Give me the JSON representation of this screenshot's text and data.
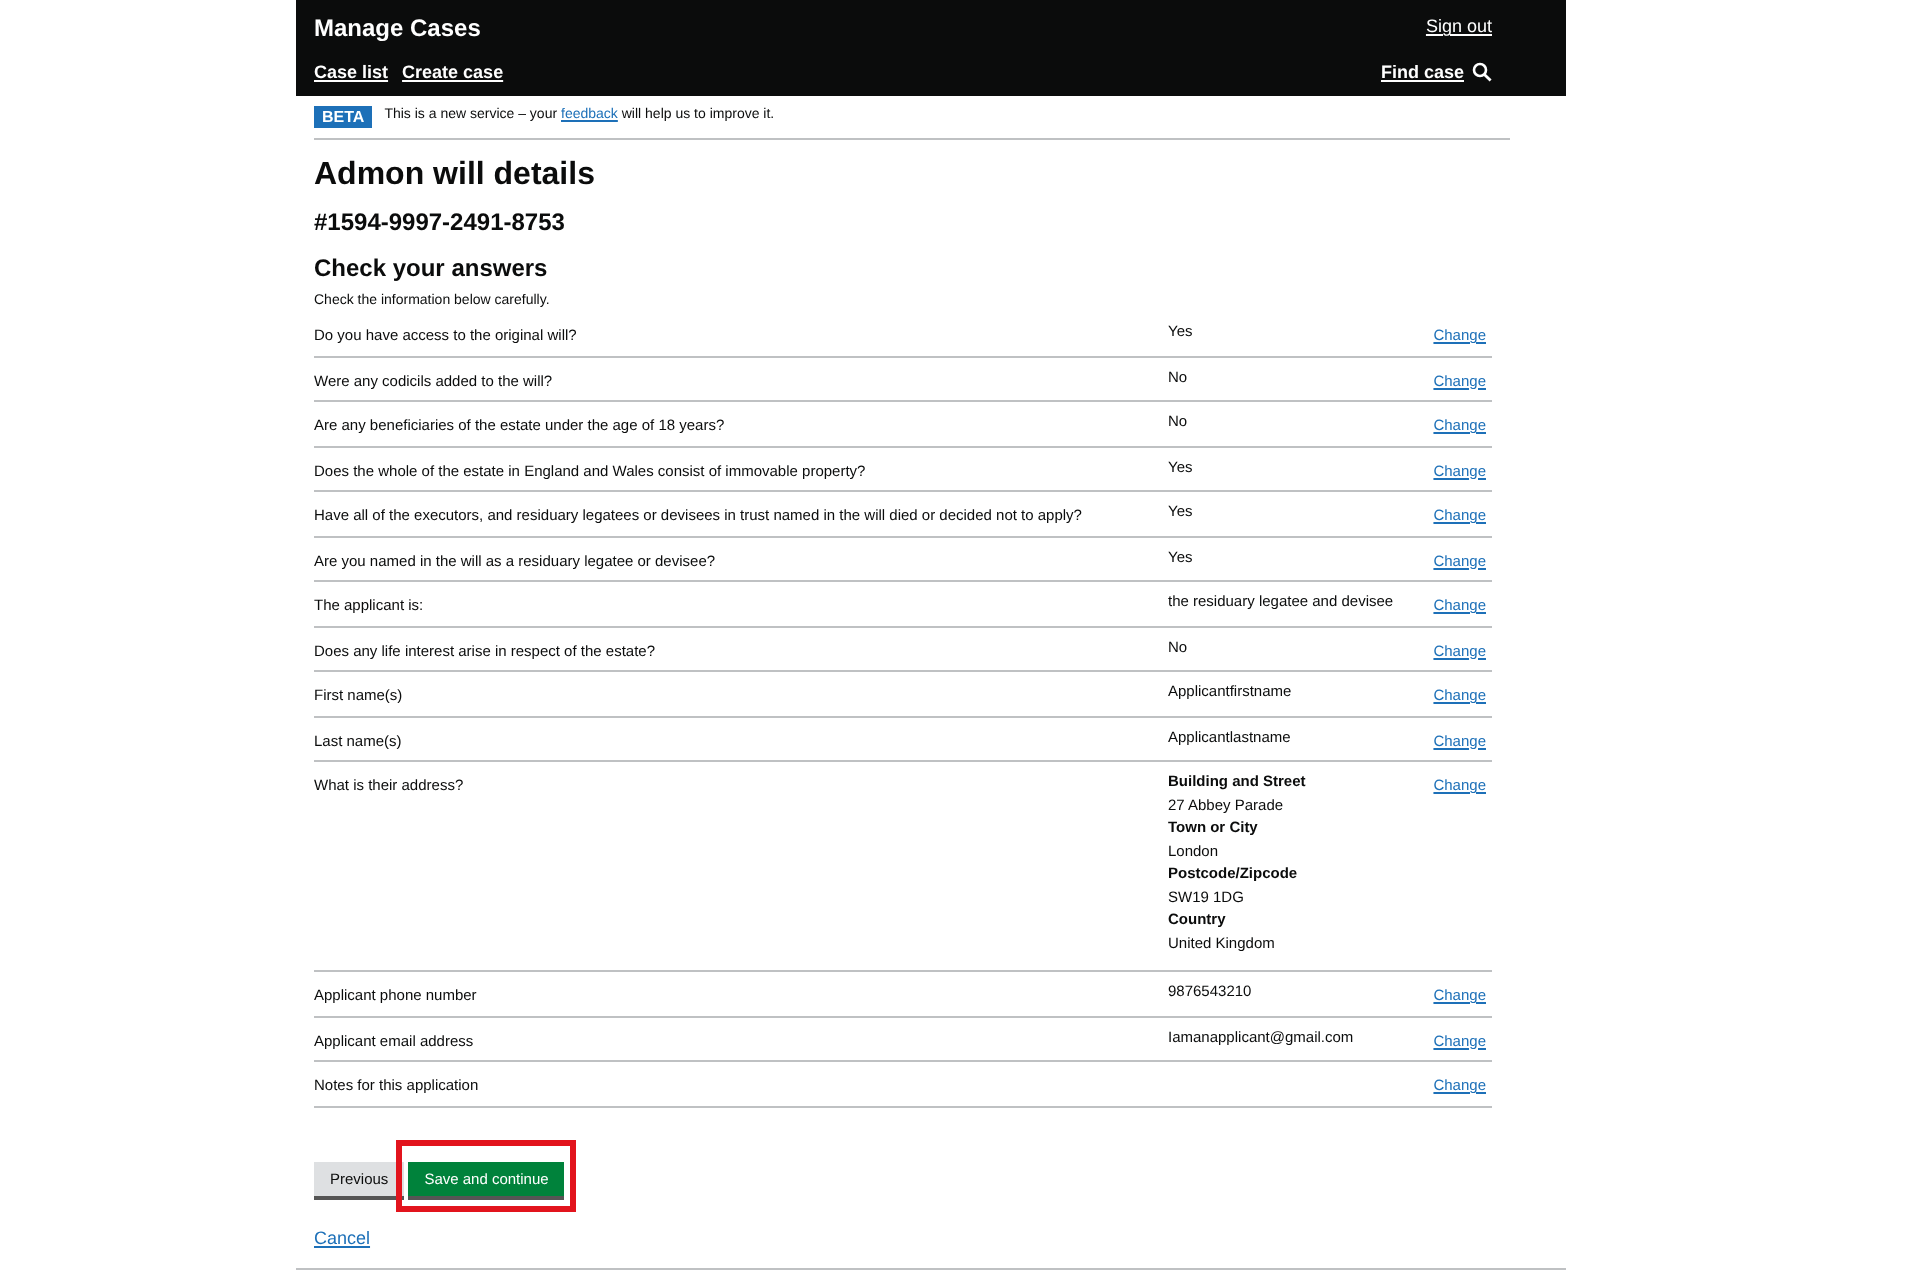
{
  "header": {
    "title": "Manage Cases",
    "sign_out": "Sign out",
    "nav": [
      "Case list",
      "Create case"
    ],
    "find_case": "Find case"
  },
  "beta": {
    "tag": "BETA",
    "text_before": "This is a new service – your",
    "link": "feedback",
    "text_after": "will help us to improve it."
  },
  "page_title": "Admon will details",
  "case_number": "#1594-9997-2491-8753",
  "section_title": "Check your answers",
  "intro": "Check the information below carefully.",
  "rows": [
    {
      "question": "Do you have access to the original will?",
      "value": "Yes",
      "action": "Change"
    },
    {
      "question": "Were any codicils added to the will?",
      "value": "No",
      "action": "Change"
    },
    {
      "question": "Are any beneficiaries of the estate under the age of 18 years?",
      "value": "No",
      "action": "Change"
    },
    {
      "question": "Does the whole of the estate in England and Wales consist of immovable property?",
      "value": "Yes",
      "action": "Change"
    },
    {
      "question": "Have all of the executors, and residuary legatees or devisees in trust named in the will died or decided not to apply?",
      "value": "Yes",
      "action": "Change"
    },
    {
      "question": "Are you named in the will as a residuary legatee or devisee?",
      "value": "Yes",
      "action": "Change"
    },
    {
      "question": "The applicant is:",
      "value": "the residuary legatee and devisee",
      "action": "Change"
    },
    {
      "question": "Does any life interest arise in respect of the estate?",
      "value": "No",
      "action": "Change"
    },
    {
      "question": "First name(s)",
      "value": "Applicantfirstname",
      "action": "Change"
    },
    {
      "question": "Last name(s)",
      "value": "Applicantlastname",
      "action": "Change"
    },
    {
      "question": "What is their address?",
      "address": [
        {
          "label": "Building and Street",
          "value": "27 Abbey Parade"
        },
        {
          "label": "Town or City",
          "value": "London"
        },
        {
          "label": "Postcode/Zipcode",
          "value": "SW19 1DG"
        },
        {
          "label": "Country",
          "value": "United Kingdom"
        }
      ],
      "action": "Change"
    },
    {
      "question": "Applicant phone number",
      "value": "9876543210",
      "action": "Change"
    },
    {
      "question": "Applicant email address",
      "value": "Iamanapplicant@gmail.com",
      "action": "Change"
    },
    {
      "question": "Notes for this application",
      "action": "Change"
    }
  ],
  "buttons": [
    {
      "label": "Previous",
      "kind": "secondary",
      "highlighted": false
    },
    {
      "label": "Save and continue",
      "kind": "primary",
      "highlighted": true
    }
  ],
  "cancel": "Cancel"
}
